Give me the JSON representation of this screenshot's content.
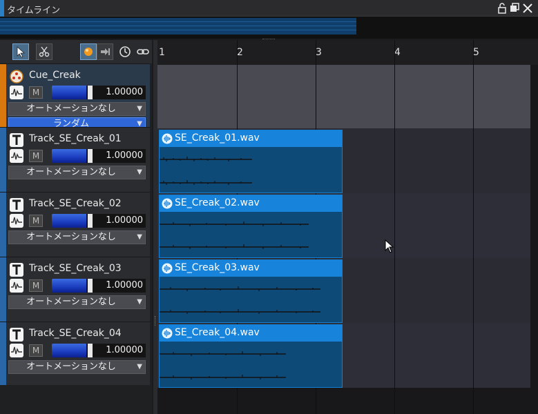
{
  "window": {
    "title": "タイムライン",
    "accent_color": "#2d7fc4",
    "buttons": [
      "lock-icon",
      "restore-icon",
      "close-icon"
    ]
  },
  "toolbar": {
    "tools": [
      "select-arrow-icon",
      "cut-scissors-icon",
      "record-orb-icon",
      "jump-icon",
      "clock-icon",
      "link-icon"
    ]
  },
  "cue": {
    "name": "Cue_Creak",
    "mute_label": "M",
    "volume": "1.00000",
    "volume_level": 1.0,
    "automation": "オートメーションなし",
    "playback_mode": "ランダム",
    "stripe_color": "#d9780f"
  },
  "tracks": [
    {
      "name": "Track_SE_Creak_01",
      "mute_label": "M",
      "volume": "1.00000",
      "automation": "オートメーションなし",
      "clip": "SE_Creak_01.wav"
    },
    {
      "name": "Track_SE_Creak_02",
      "mute_label": "M",
      "volume": "1.00000",
      "automation": "オートメーションなし",
      "clip": "SE_Creak_02.wav"
    },
    {
      "name": "Track_SE_Creak_03",
      "mute_label": "M",
      "volume": "1.00000",
      "automation": "オートメーションなし",
      "clip": "SE_Creak_03.wav"
    },
    {
      "name": "Track_SE_Creak_04",
      "mute_label": "M",
      "volume": "1.00000",
      "automation": "オートメーションなし",
      "clip": "SE_Creak_04.wav"
    }
  ],
  "ruler": {
    "marks": [
      "1",
      "2",
      "3",
      "4",
      "5"
    ]
  },
  "colors": {
    "track_stripe": "#2a67a8",
    "clip_header": "#1783da",
    "clip_body": "#0d4a78",
    "cue_lane": "#4a4a52",
    "track_lane": "#2a2b33"
  }
}
